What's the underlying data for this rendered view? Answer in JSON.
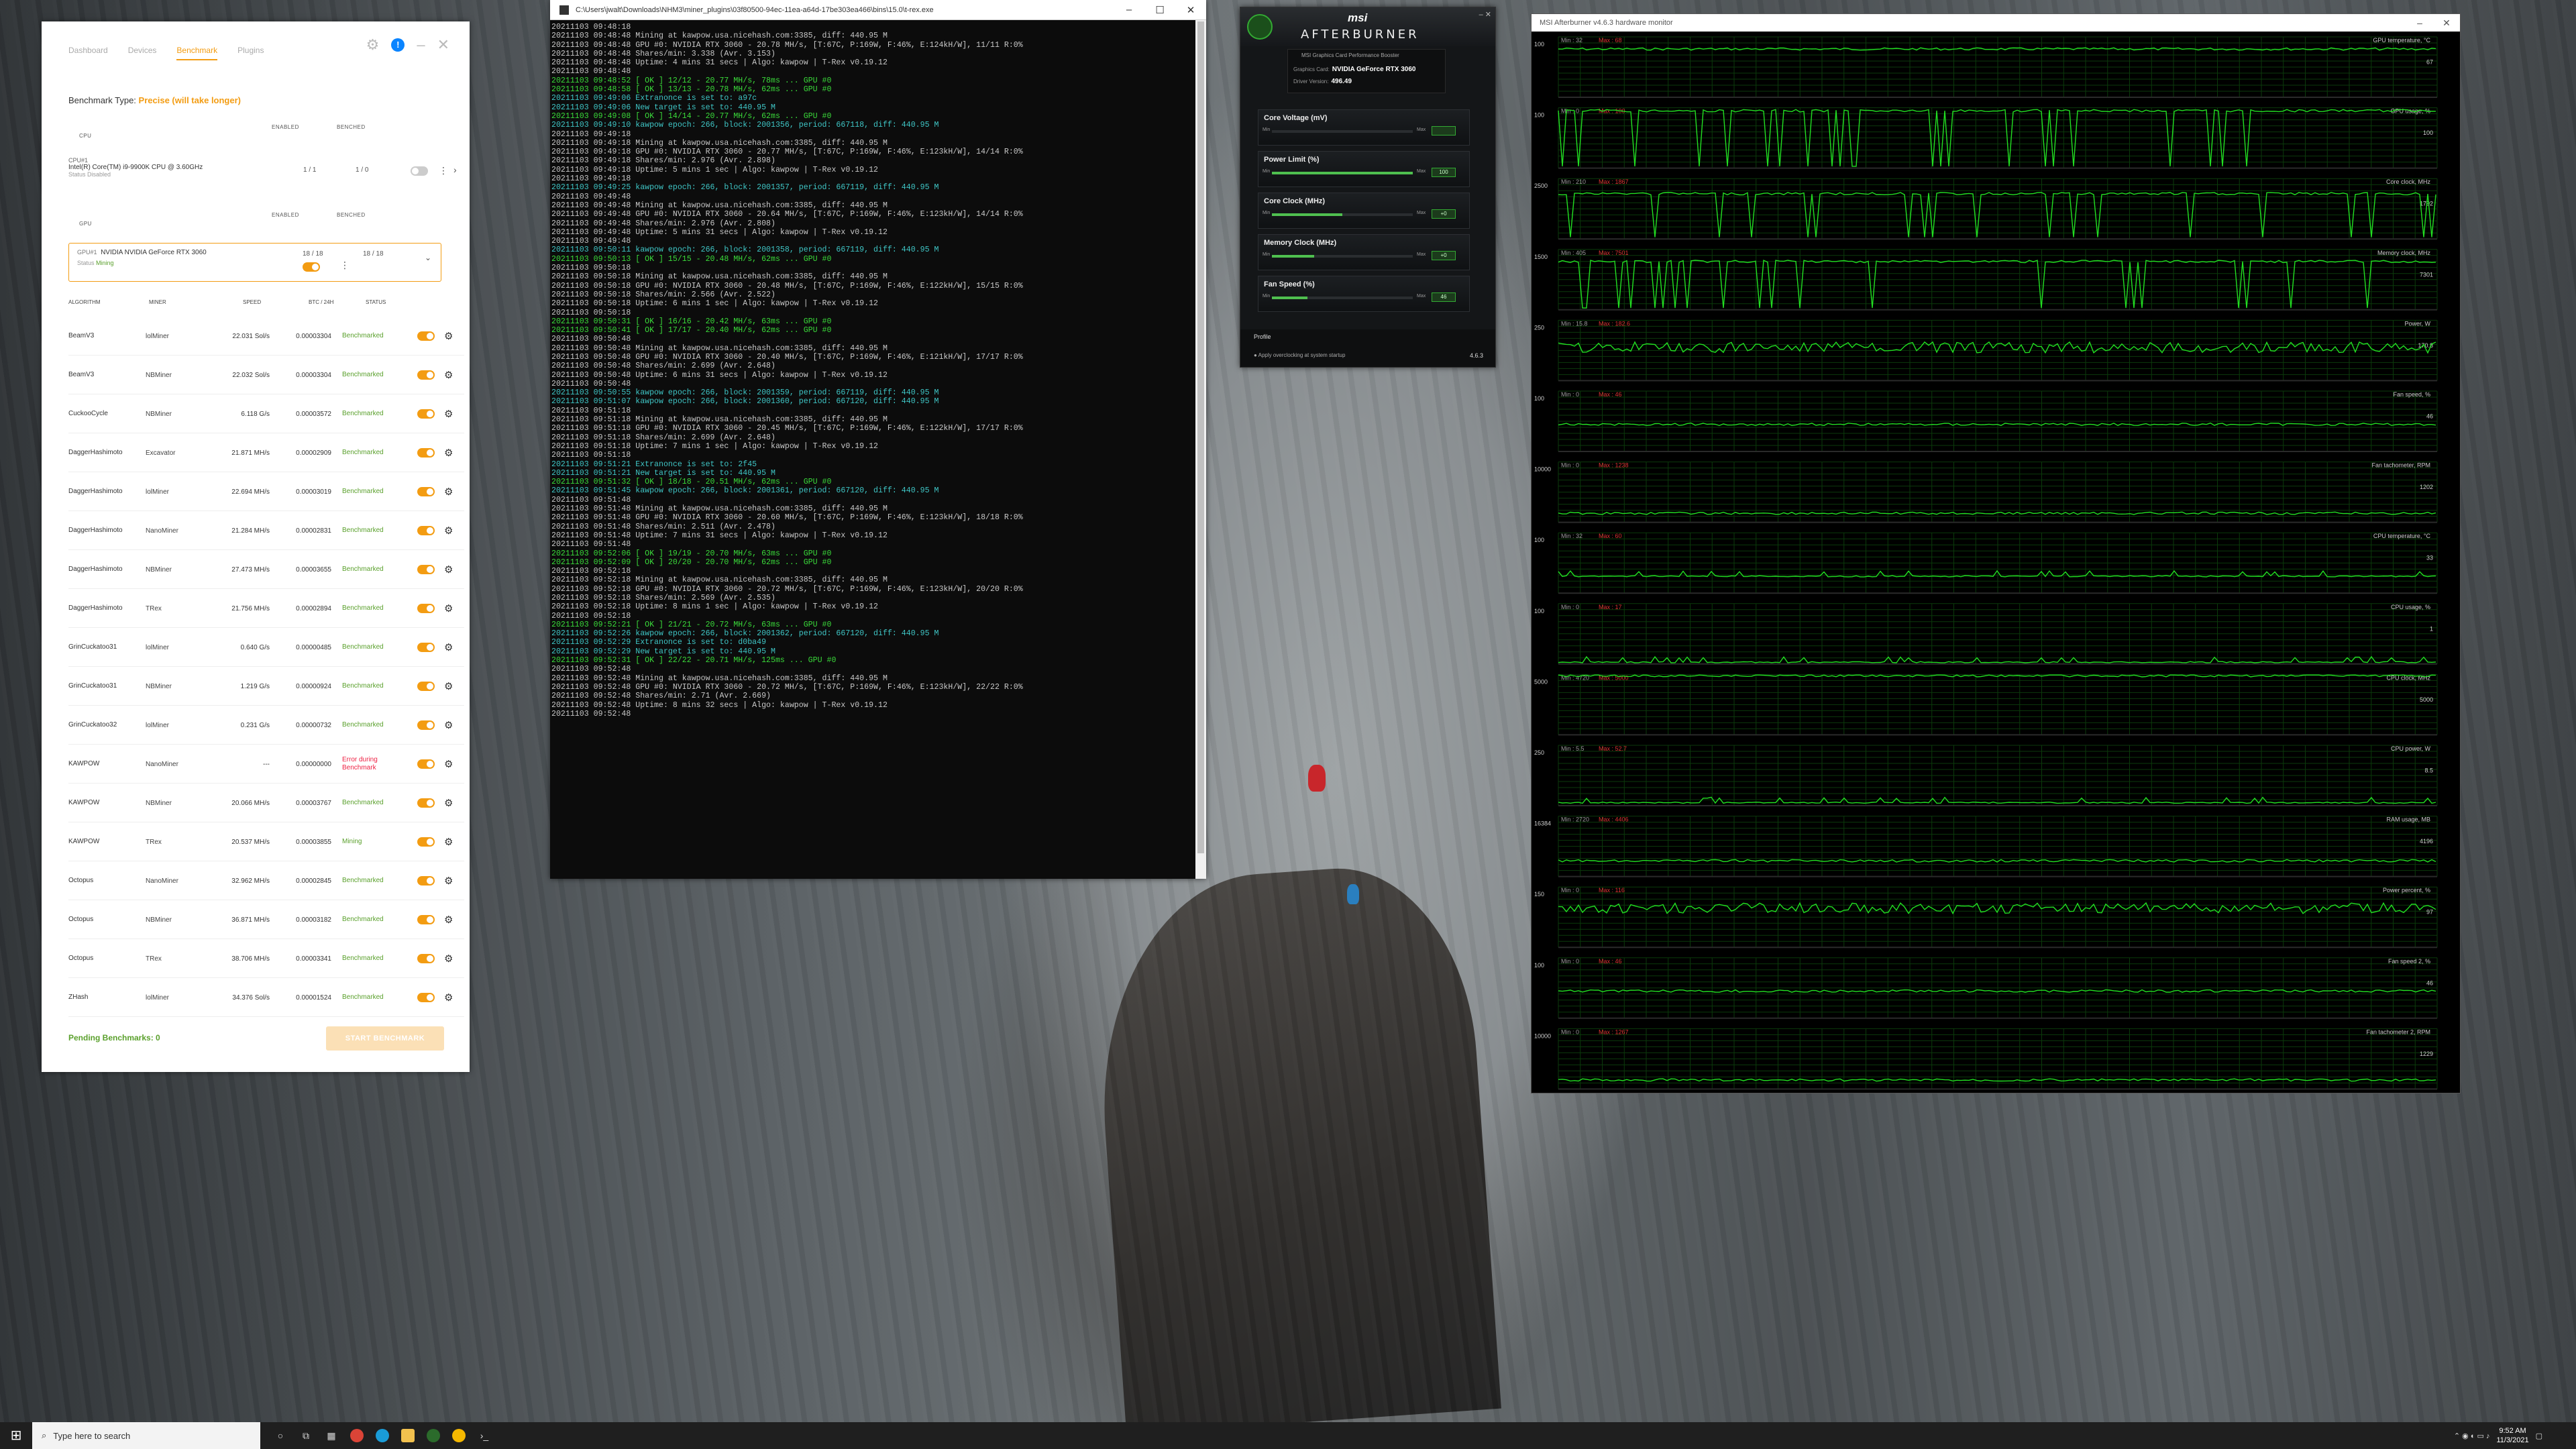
{
  "nicehash": {
    "tabs": [
      "Dashboard",
      "Devices",
      "Benchmark",
      "Plugins"
    ],
    "active_tab": 2,
    "benchmark_type_label": "Benchmark Type:",
    "benchmark_type_value": "Precise (will take longer)",
    "cpu_section": "CPU",
    "gpu_section": "GPU",
    "enabled_header": "ENABLED",
    "benched_header": "BENCHED",
    "cpu": {
      "id": "CPU#1",
      "name": "Intel(R) Core(TM) i9-9900K CPU @ 3.60GHz",
      "status_label": "Status",
      "status_value": "Disabled",
      "enabled": "1 / 1",
      "benched": "1 / 0"
    },
    "gpu": {
      "id": "GPU#1",
      "name": "NVIDIA NVIDIA GeForce RTX 3060",
      "status_label": "Status",
      "status_value": "Mining",
      "enabled": "18 / 18",
      "benched": "18 / 18"
    },
    "table_headers": {
      "algorithm": "ALGORITHM",
      "miner": "MINER",
      "speed": "SPEED",
      "btc": "BTC / 24H",
      "status": "STATUS"
    },
    "rows": [
      {
        "algorithm": "BeamV3",
        "miner": "lolMiner",
        "speed": "22.031 Sol/s",
        "btc": "0.00003304",
        "status": "Benchmarked",
        "state": "ok"
      },
      {
        "algorithm": "BeamV3",
        "miner": "NBMiner",
        "speed": "22.032 Sol/s",
        "btc": "0.00003304",
        "status": "Benchmarked",
        "state": "ok"
      },
      {
        "algorithm": "CuckooCycle",
        "miner": "NBMiner",
        "speed": "6.118 G/s",
        "btc": "0.00003572",
        "status": "Benchmarked",
        "state": "ok"
      },
      {
        "algorithm": "DaggerHashimoto",
        "miner": "Excavator",
        "speed": "21.871 MH/s",
        "btc": "0.00002909",
        "status": "Benchmarked",
        "state": "ok"
      },
      {
        "algorithm": "DaggerHashimoto",
        "miner": "lolMiner",
        "speed": "22.694 MH/s",
        "btc": "0.00003019",
        "status": "Benchmarked",
        "state": "ok"
      },
      {
        "algorithm": "DaggerHashimoto",
        "miner": "NanoMiner",
        "speed": "21.284 MH/s",
        "btc": "0.00002831",
        "status": "Benchmarked",
        "state": "ok"
      },
      {
        "algorithm": "DaggerHashimoto",
        "miner": "NBMiner",
        "speed": "27.473 MH/s",
        "btc": "0.00003655",
        "status": "Benchmarked",
        "state": "ok"
      },
      {
        "algorithm": "DaggerHashimoto",
        "miner": "TRex",
        "speed": "21.756 MH/s",
        "btc": "0.00002894",
        "status": "Benchmarked",
        "state": "ok"
      },
      {
        "algorithm": "GrinCuckatoo31",
        "miner": "lolMiner",
        "speed": "0.640 G/s",
        "btc": "0.00000485",
        "status": "Benchmarked",
        "state": "ok"
      },
      {
        "algorithm": "GrinCuckatoo31",
        "miner": "NBMiner",
        "speed": "1.219 G/s",
        "btc": "0.00000924",
        "status": "Benchmarked",
        "state": "ok"
      },
      {
        "algorithm": "GrinCuckatoo32",
        "miner": "lolMiner",
        "speed": "0.231 G/s",
        "btc": "0.00000732",
        "status": "Benchmarked",
        "state": "ok"
      },
      {
        "algorithm": "KAWPOW",
        "miner": "NanoMiner",
        "speed": "---",
        "btc": "0.00000000",
        "status": "Error during Benchmark",
        "state": "err"
      },
      {
        "algorithm": "KAWPOW",
        "miner": "NBMiner",
        "speed": "20.066 MH/s",
        "btc": "0.00003767",
        "status": "Benchmarked",
        "state": "ok"
      },
      {
        "algorithm": "KAWPOW",
        "miner": "TRex",
        "speed": "20.537 MH/s",
        "btc": "0.00003855",
        "status": "Mining",
        "state": "mining"
      },
      {
        "algorithm": "Octopus",
        "miner": "NanoMiner",
        "speed": "32.962 MH/s",
        "btc": "0.00002845",
        "status": "Benchmarked",
        "state": "ok"
      },
      {
        "algorithm": "Octopus",
        "miner": "NBMiner",
        "speed": "36.871 MH/s",
        "btc": "0.00003182",
        "status": "Benchmarked",
        "state": "ok"
      },
      {
        "algorithm": "Octopus",
        "miner": "TRex",
        "speed": "38.706 MH/s",
        "btc": "0.00003341",
        "status": "Benchmarked",
        "state": "ok"
      },
      {
        "algorithm": "ZHash",
        "miner": "lolMiner",
        "speed": "34.376 Sol/s",
        "btc": "0.00001524",
        "status": "Benchmarked",
        "state": "ok"
      }
    ],
    "pending_label": "Pending Benchmarks: 0",
    "start_button": "START BENCHMARK",
    "colors": {
      "accent": "#f39c12",
      "ok": "#5aa02c",
      "error": "#e22244"
    }
  },
  "console": {
    "title": "C:\\Users\\jwalt\\Downloads\\NHM3\\miner_plugins\\03f80500-94ec-11ea-a64d-17be303ea466\\bins\\15.0\\t-rex.exe",
    "lines": [
      [
        "w",
        "20211103 09:48:18"
      ],
      [
        "w",
        "20211103 09:48:48 Mining at kawpow.usa.nicehash.com:3385, diff: 440.95 M"
      ],
      [
        "w",
        "20211103 09:48:48 GPU #0: NVIDIA RTX 3060 - 20.78 MH/s, [T:67C, P:169W, F:46%, E:124kH/W], 11/11 R:0%"
      ],
      [
        "w",
        "20211103 09:48:48 Shares/min: 3.338 (Avr. 3.153)"
      ],
      [
        "w",
        "20211103 09:48:48 Uptime: 4 mins 31 secs | Algo: kawpow | T-Rex v0.19.12"
      ],
      [
        "w",
        "20211103 09:48:48"
      ],
      [
        "g",
        "20211103 09:48:52 [ OK ] 12/12 - 20.77 MH/s, 78ms ... GPU #0"
      ],
      [
        "g",
        "20211103 09:48:58 [ OK ] 13/13 - 20.78 MH/s, 62ms ... GPU #0"
      ],
      [
        "c",
        "20211103 09:49:06 Extranonce is set to: a97c"
      ],
      [
        "c",
        "20211103 09:49:06 New target is set to: 440.95 M"
      ],
      [
        "g",
        "20211103 09:49:08 [ OK ] 14/14 - 20.77 MH/s, 62ms ... GPU #0"
      ],
      [
        "c",
        "20211103 09:49:10 kawpow epoch: 266, block: 2001356, period: 667118, diff: 440.95 M"
      ],
      [
        "w",
        "20211103 09:49:18"
      ],
      [
        "w",
        "20211103 09:49:18 Mining at kawpow.usa.nicehash.com:3385, diff: 440.95 M"
      ],
      [
        "w",
        "20211103 09:49:18 GPU #0: NVIDIA RTX 3060 - 20.77 MH/s, [T:67C, P:169W, F:46%, E:123kH/W], 14/14 R:0%"
      ],
      [
        "w",
        "20211103 09:49:18 Shares/min: 2.976 (Avr. 2.898)"
      ],
      [
        "w",
        "20211103 09:49:18 Uptime: 5 mins 1 sec | Algo: kawpow | T-Rex v0.19.12"
      ],
      [
        "w",
        "20211103 09:49:18"
      ],
      [
        "c",
        "20211103 09:49:25 kawpow epoch: 266, block: 2001357, period: 667119, diff: 440.95 M"
      ],
      [
        "w",
        "20211103 09:49:48"
      ],
      [
        "w",
        "20211103 09:49:48 Mining at kawpow.usa.nicehash.com:3385, diff: 440.95 M"
      ],
      [
        "w",
        "20211103 09:49:48 GPU #0: NVIDIA RTX 3060 - 20.64 MH/s, [T:67C, P:169W, F:46%, E:123kH/W], 14/14 R:0%"
      ],
      [
        "w",
        "20211103 09:49:48 Shares/min: 2.976 (Avr. 2.808)"
      ],
      [
        "w",
        "20211103 09:49:48 Uptime: 5 mins 31 secs | Algo: kawpow | T-Rex v0.19.12"
      ],
      [
        "w",
        "20211103 09:49:48"
      ],
      [
        "c",
        "20211103 09:50:11 kawpow epoch: 266, block: 2001358, period: 667119, diff: 440.95 M"
      ],
      [
        "g",
        "20211103 09:50:13 [ OK ] 15/15 - 20.48 MH/s, 62ms ... GPU #0"
      ],
      [
        "w",
        "20211103 09:50:18"
      ],
      [
        "w",
        "20211103 09:50:18 Mining at kawpow.usa.nicehash.com:3385, diff: 440.95 M"
      ],
      [
        "w",
        "20211103 09:50:18 GPU #0: NVIDIA RTX 3060 - 20.48 MH/s, [T:67C, P:169W, F:46%, E:122kH/W], 15/15 R:0%"
      ],
      [
        "w",
        "20211103 09:50:18 Shares/min: 2.566 (Avr. 2.522)"
      ],
      [
        "w",
        "20211103 09:50:18 Uptime: 6 mins 1 sec | Algo: kawpow | T-Rex v0.19.12"
      ],
      [
        "w",
        "20211103 09:50:18"
      ],
      [
        "g",
        "20211103 09:50:31 [ OK ] 16/16 - 20.42 MH/s, 63ms ... GPU #0"
      ],
      [
        "g",
        "20211103 09:50:41 [ OK ] 17/17 - 20.40 MH/s, 62ms ... GPU #0"
      ],
      [
        "w",
        "20211103 09:50:48"
      ],
      [
        "w",
        "20211103 09:50:48 Mining at kawpow.usa.nicehash.com:3385, diff: 440.95 M"
      ],
      [
        "w",
        "20211103 09:50:48 GPU #0: NVIDIA RTX 3060 - 20.40 MH/s, [T:67C, P:169W, F:46%, E:121kH/W], 17/17 R:0%"
      ],
      [
        "w",
        "20211103 09:50:48 Shares/min: 2.699 (Avr. 2.648)"
      ],
      [
        "w",
        "20211103 09:50:48 Uptime: 6 mins 31 secs | Algo: kawpow | T-Rex v0.19.12"
      ],
      [
        "w",
        "20211103 09:50:48"
      ],
      [
        "c",
        "20211103 09:50:55 kawpow epoch: 266, block: 2001359, period: 667119, diff: 440.95 M"
      ],
      [
        "c",
        "20211103 09:51:07 kawpow epoch: 266, block: 2001360, period: 667120, diff: 440.95 M"
      ],
      [
        "w",
        "20211103 09:51:18"
      ],
      [
        "w",
        "20211103 09:51:18 Mining at kawpow.usa.nicehash.com:3385, diff: 440.95 M"
      ],
      [
        "w",
        "20211103 09:51:18 GPU #0: NVIDIA RTX 3060 - 20.45 MH/s, [T:67C, P:169W, F:46%, E:122kH/W], 17/17 R:0%"
      ],
      [
        "w",
        "20211103 09:51:18 Shares/min: 2.699 (Avr. 2.648)"
      ],
      [
        "w",
        "20211103 09:51:18 Uptime: 7 mins 1 sec | Algo: kawpow | T-Rex v0.19.12"
      ],
      [
        "w",
        "20211103 09:51:18"
      ],
      [
        "c",
        "20211103 09:51:21 Extranonce is set to: 2f45"
      ],
      [
        "c",
        "20211103 09:51:21 New target is set to: 440.95 M"
      ],
      [
        "g",
        "20211103 09:51:32 [ OK ] 18/18 - 20.51 MH/s, 62ms ... GPU #0"
      ],
      [
        "c",
        "20211103 09:51:45 kawpow epoch: 266, block: 2001361, period: 667120, diff: 440.95 M"
      ],
      [
        "w",
        "20211103 09:51:48"
      ],
      [
        "w",
        "20211103 09:51:48 Mining at kawpow.usa.nicehash.com:3385, diff: 440.95 M"
      ],
      [
        "w",
        "20211103 09:51:48 GPU #0: NVIDIA RTX 3060 - 20.60 MH/s, [T:67C, P:169W, F:46%, E:123kH/W], 18/18 R:0%"
      ],
      [
        "w",
        "20211103 09:51:48 Shares/min: 2.511 (Avr. 2.478)"
      ],
      [
        "w",
        "20211103 09:51:48 Uptime: 7 mins 31 secs | Algo: kawpow | T-Rex v0.19.12"
      ],
      [
        "w",
        "20211103 09:51:48"
      ],
      [
        "g",
        "20211103 09:52:06 [ OK ] 19/19 - 20.70 MH/s, 63ms ... GPU #0"
      ],
      [
        "g",
        "20211103 09:52:09 [ OK ] 20/20 - 20.70 MH/s, 62ms ... GPU #0"
      ],
      [
        "w",
        "20211103 09:52:18"
      ],
      [
        "w",
        "20211103 09:52:18 Mining at kawpow.usa.nicehash.com:3385, diff: 440.95 M"
      ],
      [
        "w",
        "20211103 09:52:18 GPU #0: NVIDIA RTX 3060 - 20.72 MH/s, [T:67C, P:169W, F:46%, E:123kH/W], 20/20 R:0%"
      ],
      [
        "w",
        "20211103 09:52:18 Shares/min: 2.569 (Avr. 2.535)"
      ],
      [
        "w",
        "20211103 09:52:18 Uptime: 8 mins 1 sec | Algo: kawpow | T-Rex v0.19.12"
      ],
      [
        "w",
        "20211103 09:52:18"
      ],
      [
        "g",
        "20211103 09:52:21 [ OK ] 21/21 - 20.72 MH/s, 63ms ... GPU #0"
      ],
      [
        "c",
        "20211103 09:52:26 kawpow epoch: 266, block: 2001362, period: 667120, diff: 440.95 M"
      ],
      [
        "c",
        "20211103 09:52:29 Extranonce is set to: d0ba49"
      ],
      [
        "c",
        "20211103 09:52:29 New target is set to: 440.95 M"
      ],
      [
        "g",
        "20211103 09:52:31 [ OK ] 22/22 - 20.71 MH/s, 125ms ... GPU #0"
      ],
      [
        "w",
        "20211103 09:52:48"
      ],
      [
        "w",
        "20211103 09:52:48 Mining at kawpow.usa.nicehash.com:3385, diff: 440.95 M"
      ],
      [
        "w",
        "20211103 09:52:48 GPU #0: NVIDIA RTX 3060 - 20.72 MH/s, [T:67C, P:169W, F:46%, E:123kH/W], 22/22 R:0%"
      ],
      [
        "w",
        "20211103 09:52:48 Shares/min: 2.71 (Avr. 2.669)"
      ],
      [
        "w",
        "20211103 09:52:48 Uptime: 8 mins 32 secs | Algo: kawpow | T-Rex v0.19.12"
      ],
      [
        "w",
        "20211103 09:52:48"
      ]
    ]
  },
  "afterburner": {
    "brand_top": "msi",
    "brand_name": "AFTERBURNER",
    "subtitle": "MSI Graphics Card Performance Booster",
    "card_label": "Graphics Card:",
    "card_value": "NVIDIA GeForce RTX 3060",
    "driver_label": "Driver Version:",
    "driver_value": "496.49",
    "sliders": [
      {
        "label": "Core Voltage (mV)",
        "fill": 0.0,
        "value": ""
      },
      {
        "label": "Power Limit (%)",
        "fill": 1.0,
        "value": "100"
      },
      {
        "label": "Core Clock (MHz)",
        "fill": 0.5,
        "value": "+0"
      },
      {
        "label": "Memory Clock (MHz)",
        "fill": 0.3,
        "value": "+0"
      },
      {
        "label": "Fan Speed (%)",
        "fill": 0.25,
        "value": "46"
      }
    ],
    "min_label": "Min",
    "max_label": "Max",
    "profile_label": "Profile",
    "startup_label": "Apply overclocking at system startup",
    "version": "4.6.3"
  },
  "monitor": {
    "title": "MSI Afterburner v4.6.3 hardware monitor",
    "graphs": [
      {
        "name": "GPU temperature, °C",
        "scale": "100",
        "min": "Min : 32",
        "max": "Max : 68",
        "value": "67"
      },
      {
        "name": "GPU usage, %",
        "scale": "100",
        "min": "Min : 0",
        "max": "Max : 100",
        "value": "100"
      },
      {
        "name": "Core clock, MHz",
        "scale": "2500",
        "min": "Min : 210",
        "max": "Max : 1867",
        "value": "1792"
      },
      {
        "name": "Memory clock, MHz",
        "scale": "1500",
        "min": "Min : 405",
        "max": "Max : 7501",
        "value": "7301"
      },
      {
        "name": "Power, W",
        "scale": "250",
        "min": "Min : 15.8",
        "max": "Max : 182.6",
        "value": "170.8"
      },
      {
        "name": "Fan speed, %",
        "scale": "100",
        "min": "Min : 0",
        "max": "Max : 46",
        "value": "46"
      },
      {
        "name": "Fan tachometer, RPM",
        "scale": "10000",
        "min": "Min : 0",
        "max": "Max : 1238",
        "value": "1202"
      },
      {
        "name": "CPU temperature, °C",
        "scale": "100",
        "min": "Min : 32",
        "max": "Max : 60",
        "value": "33"
      },
      {
        "name": "CPU usage, %",
        "scale": "100",
        "min": "Min : 0",
        "max": "Max : 17",
        "value": "1"
      },
      {
        "name": "CPU clock, MHz",
        "scale": "5000",
        "min": "Min : 4720",
        "max": "Max : 5000",
        "value": "5000"
      },
      {
        "name": "CPU power, W",
        "scale": "250",
        "min": "Min : 5.5",
        "max": "Max : 52.7",
        "value": "8.5"
      },
      {
        "name": "RAM usage, MB",
        "scale": "16384",
        "min": "Min : 2720",
        "max": "Max : 4406",
        "value": "4196"
      },
      {
        "name": "Power percent, %",
        "scale": "150",
        "min": "Min : 0",
        "max": "Max : 116",
        "value": "97"
      },
      {
        "name": "Fan speed 2, %",
        "scale": "100",
        "min": "Min : 0",
        "max": "Max : 46",
        "value": "46"
      },
      {
        "name": "Fan tachometer 2, RPM",
        "scale": "10000",
        "min": "Min : 0",
        "max": "Max : 1267",
        "value": "1229"
      }
    ]
  },
  "taskbar": {
    "search_placeholder": "Type here to search",
    "time": "9:52 AM",
    "date": "11/3/2021"
  }
}
